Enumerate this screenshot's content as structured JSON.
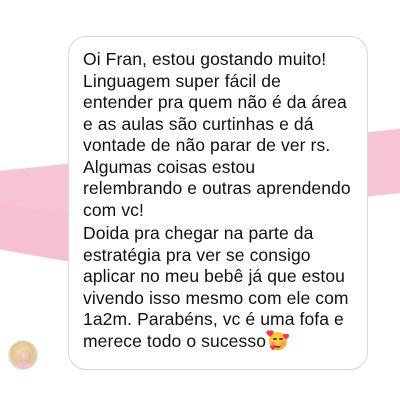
{
  "message": {
    "paragraphs": [
      "Oi Fran, estou gostando muito! Linguagem super fácil de entender pra quem não é da área e as aulas são curtinhas e dá vontade de não parar de ver rs. Algumas coisas estou relembrando e outras aprendendo com vc!",
      "Doida pra chegar na parte da estratégia pra ver se consigo aplicar no meu bebê já que estou vivendo isso mesmo com ele com 1a2m. Parabéns, vc é uma fofa e merece todo o sucesso"
    ],
    "emoji": "smiling-face-with-hearts-emoji"
  },
  "colors": {
    "background": "#ffffff",
    "accent_pink": "#f7c4d3",
    "bubble_border": "#d9d9d9",
    "text": "#111111"
  }
}
